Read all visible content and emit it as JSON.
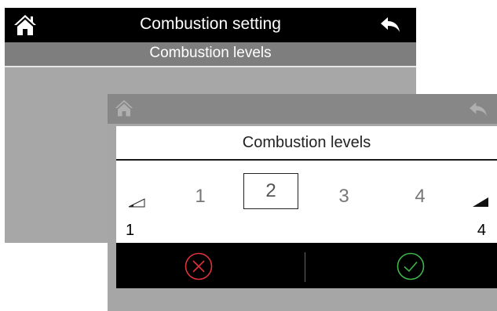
{
  "background_screen": {
    "title": "Combustion setting",
    "subtitle": "Combustion levels"
  },
  "dialog": {
    "title": "Combustion levels",
    "levels": [
      "1",
      "2",
      "3",
      "4"
    ],
    "selected_level": "2",
    "min_label": "1",
    "max_label": "4"
  },
  "colors": {
    "cancel": "#e0313a",
    "confirm": "#3fb54a",
    "header": "#000000",
    "screen_gray": "#a7a7a7"
  },
  "icons": {
    "home": "home-icon",
    "back": "back-arrow-icon",
    "cancel": "cancel-circle-x-icon",
    "confirm": "confirm-circle-check-icon",
    "signal_low": "signal-low-icon",
    "signal_high": "signal-high-icon"
  }
}
